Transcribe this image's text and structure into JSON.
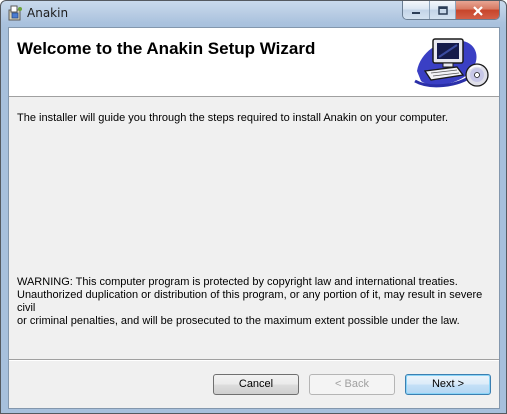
{
  "window": {
    "title": "Anakin",
    "app_icon": "installer-icon",
    "caption_buttons": [
      "minimize",
      "maximize",
      "close"
    ]
  },
  "banner": {
    "title": "Welcome to the Anakin Setup Wizard",
    "graphic": "computer-cd-graphic"
  },
  "content": {
    "intro": "The installer will guide you through the steps required to install Anakin on your computer.",
    "warning": "WARNING: This computer program is protected by copyright law and international treaties.\nUnauthorized duplication or distribution of this program, or any portion of it, may result in severe civil\nor criminal penalties, and will be prosecuted to the maximum extent possible under the law."
  },
  "buttons": {
    "cancel_label": "Cancel",
    "back_label": "< Back",
    "back_enabled": false,
    "next_label": "Next >",
    "next_default": true
  },
  "colors": {
    "titlebar": "#b9cde4",
    "client_bg": "#f0f0f0",
    "banner_bg": "#ffffff",
    "close_button": "#c7452a",
    "default_button_border": "#3c7fb1"
  }
}
